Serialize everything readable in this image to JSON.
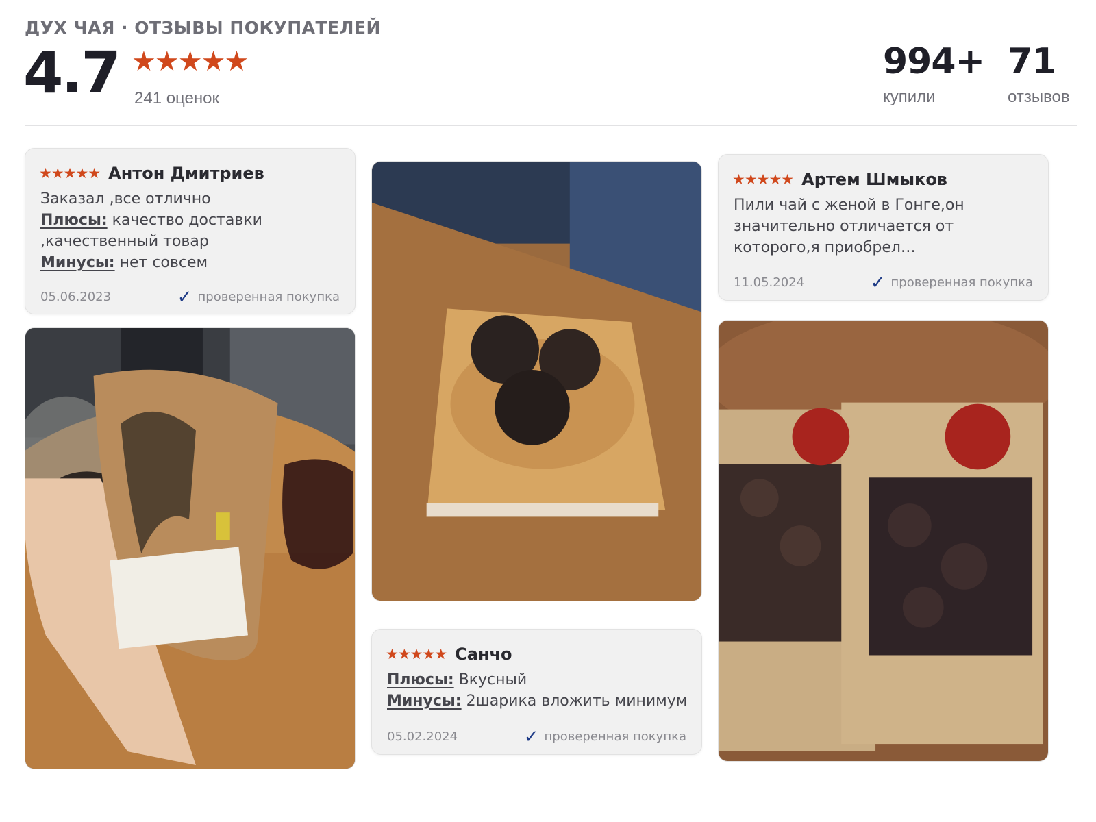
{
  "header": {
    "brand": "ДУХ ЧАЯ · ОТЗЫВЫ ПОКУПАТЕЛЕЙ",
    "rating": "4.7",
    "stars": "★★★★★",
    "rating_count": "241 оценок",
    "bought_num": "994+",
    "bought_label": "купили",
    "reviews_num": "71",
    "reviews_label": "отзывов"
  },
  "reviews": [
    {
      "stars": "★★★★★",
      "author": "Антон Дмитриев",
      "text": "Заказал ,все отлично",
      "pros_label": "Плюсы:",
      "pros": "качество доставки ,качественный товар",
      "cons_label": "Минусы:",
      "cons": "нет совсем",
      "date": "05.06.2023",
      "verified": "проверенная покупка"
    },
    {
      "stars": "★★★★★",
      "author": "Артем Шмыков",
      "text": "Пили чай с женой в Гонге,он значительно отличается от которого,я приобрел…",
      "date": "11.05.2024",
      "verified": "проверенная покупка"
    },
    {
      "stars": "★★★★★",
      "author": "Санчо",
      "pros_label": "Плюсы:",
      "pros": "Вкусный",
      "cons_label": "Минусы:",
      "cons": "2шарика вложить минимум",
      "date": "05.02.2024",
      "verified": "проверенная покупка"
    }
  ],
  "colors": {
    "star": "#d0481c",
    "check": "#1d3a86",
    "card_bg": "#f1f1f1",
    "heading": "#1f1f28",
    "muted": "#707078"
  },
  "icons": {
    "star": "star-icon",
    "check": "check-icon"
  }
}
